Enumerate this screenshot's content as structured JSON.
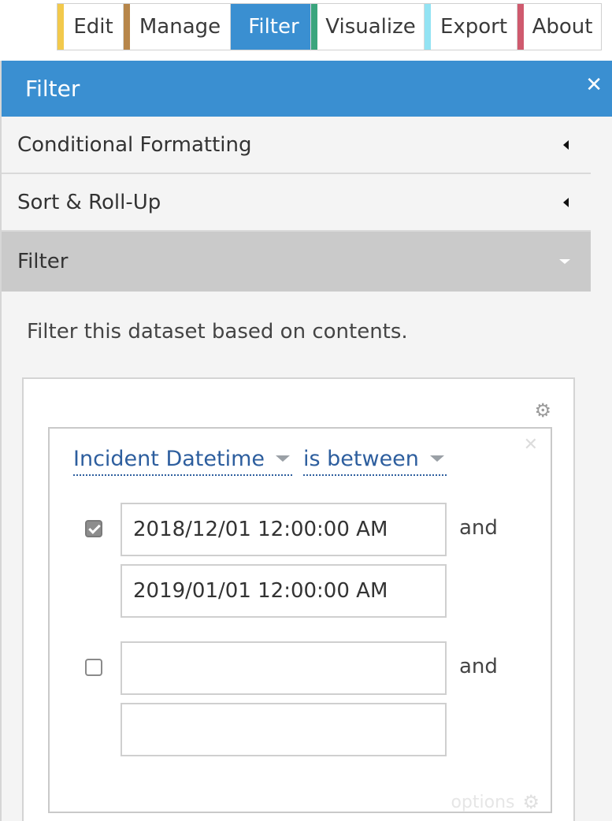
{
  "tabs": [
    {
      "label": "Edit",
      "color": "#f2c94c",
      "active": false
    },
    {
      "label": "Manage",
      "color": "#b7864a",
      "active": false
    },
    {
      "label": "Filter",
      "color": "#3a8fd1",
      "active": true
    },
    {
      "label": "Visualize",
      "color": "#3aa57d",
      "active": false
    },
    {
      "label": "Export",
      "color": "#93e3f3",
      "active": false
    },
    {
      "label": "About",
      "color": "#cf5a6e",
      "active": false
    }
  ],
  "panel": {
    "title": "Filter",
    "close_icon": "close-icon",
    "accent_color": "#3a8fd1"
  },
  "accordions": {
    "conditional_formatting": "Conditional Formatting",
    "sort_rollup": "Sort & Roll-Up",
    "filter": "Filter"
  },
  "filter": {
    "description": "Filter this dataset based on contents.",
    "column": "Incident Datetime",
    "operator": "is between",
    "conditions": [
      {
        "checked": true,
        "from": "2018/12/01 12:00:00 AM",
        "to": "2019/01/01 12:00:00 AM",
        "joiner": "and"
      },
      {
        "checked": false,
        "from": "",
        "to": "",
        "joiner": "and"
      }
    ],
    "options_label": "options"
  }
}
